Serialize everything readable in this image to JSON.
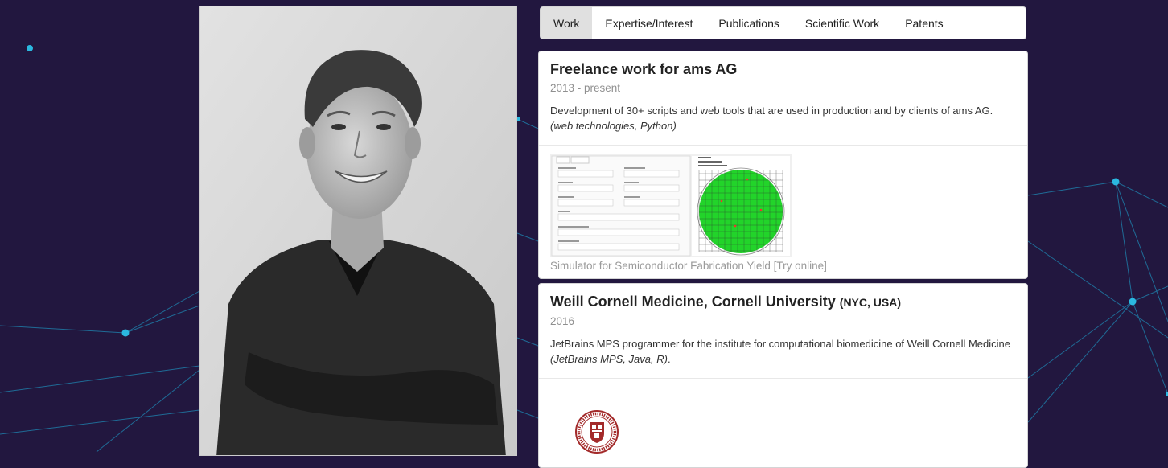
{
  "tabs": [
    "Work",
    "Expertise/Interest",
    "Publications",
    "Scientific Work",
    "Patents"
  ],
  "active_tab": "Work",
  "jobs": [
    {
      "title": "Freelance work for ams AG",
      "period": "2013 - present",
      "description": "Development of 30+ scripts and web tools that are used in production and by clients of ams AG.",
      "tech": "(web technologies, Python)",
      "caption": "Simulator for Semiconductor Fabrication Yield",
      "link_label": "[Try online]"
    },
    {
      "title": "Weill Cornell Medicine, Cornell University",
      "location": "(NYC, USA)",
      "period": "2016",
      "description": "JetBrains MPS programmer for the institute for computational biomedicine of Weill Cornell Medicine",
      "tech": "(JetBrains MPS, Java, R)",
      "tail": "."
    }
  ],
  "colors": {
    "background": "#22173f",
    "network_line": "#1e88b4",
    "network_node": "#2bb8e0",
    "active_tab": "#e0e0e0",
    "seal_red": "#a32a2a",
    "wafer_green": "#22d42a"
  },
  "icons": [
    "portrait-photo",
    "yield-simulator-screenshot",
    "cornell-seal-icon"
  ]
}
